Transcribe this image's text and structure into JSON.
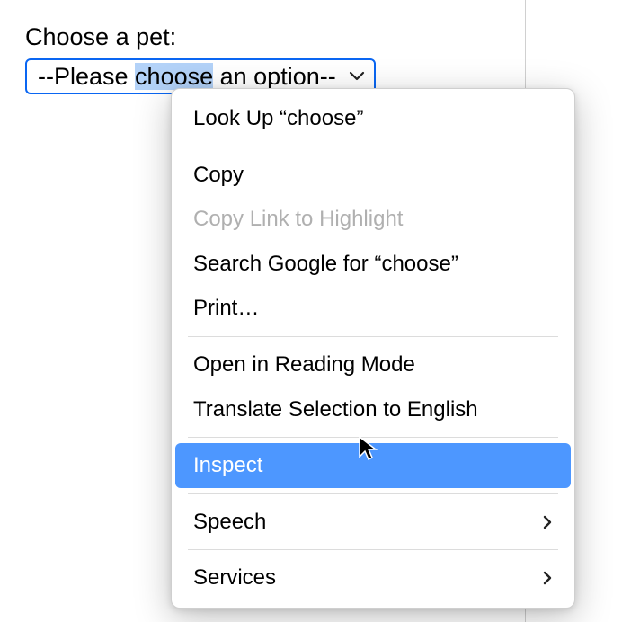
{
  "form": {
    "label": "Choose a pet:",
    "select_pre": "--Please ",
    "select_highlight": "choose",
    "select_post": " an option--"
  },
  "context_menu": {
    "items": [
      {
        "label": "Look Up “choose”",
        "enabled": true,
        "submenu": false
      },
      {
        "separator": true
      },
      {
        "label": "Copy",
        "enabled": true,
        "submenu": false
      },
      {
        "label": "Copy Link to Highlight",
        "enabled": false,
        "submenu": false
      },
      {
        "label": "Search Google for “choose”",
        "enabled": true,
        "submenu": false
      },
      {
        "label": "Print…",
        "enabled": true,
        "submenu": false
      },
      {
        "separator": true
      },
      {
        "label": "Open in Reading Mode",
        "enabled": true,
        "submenu": false
      },
      {
        "label": "Translate Selection to English",
        "enabled": true,
        "submenu": false
      },
      {
        "separator": true
      },
      {
        "label": "Inspect",
        "enabled": true,
        "highlighted": true,
        "submenu": false
      },
      {
        "separator": true
      },
      {
        "label": "Speech",
        "enabled": true,
        "submenu": true
      },
      {
        "separator": true
      },
      {
        "label": "Services",
        "enabled": true,
        "submenu": true
      }
    ]
  }
}
